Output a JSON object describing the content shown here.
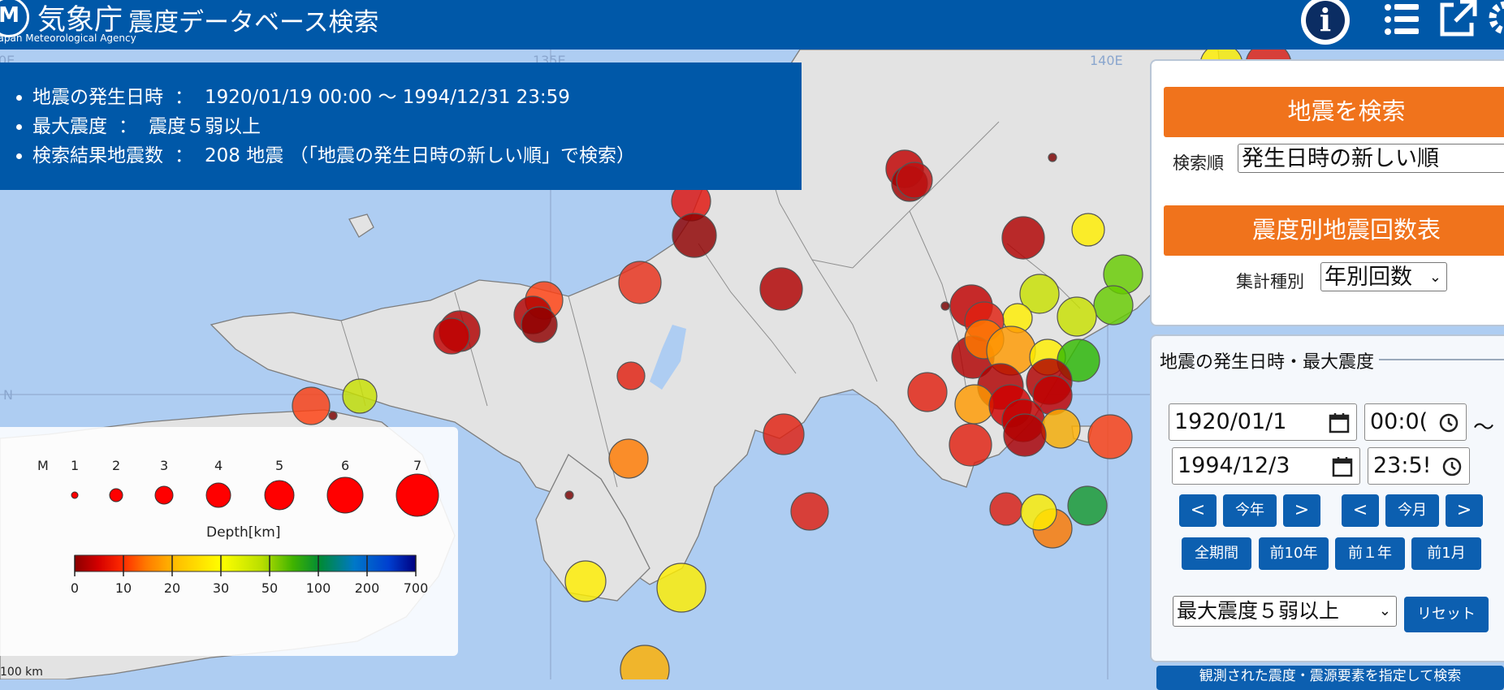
{
  "header": {
    "logo_symbol": "M",
    "agency_name": "気象庁",
    "agency_name_en": "Japan Meteorological Agency",
    "app_title": "震度データベース検索",
    "info_label": "i",
    "icons": [
      "info-icon",
      "list-icon",
      "external-link-icon",
      "gear-icon"
    ]
  },
  "map": {
    "graticule": [
      "135E",
      "140E",
      "N",
      "0E"
    ],
    "scale_label": "100 km"
  },
  "summary": {
    "items": [
      {
        "label": "地震の発生日時",
        "sep": "：",
        "value": "1920/01/19 00:00 ～ 1994/12/31 23:59"
      },
      {
        "label": "最大震度",
        "sep": "：",
        "value": "震度５弱以上"
      },
      {
        "label": "検索結果地震数",
        "sep": "：",
        "value": "208 地震 （「地震の発生日時の新しい順」で検索）"
      }
    ]
  },
  "legend": {
    "m_label": "M",
    "magnitudes": [
      "1",
      "2",
      "3",
      "4",
      "5",
      "6",
      "7"
    ],
    "depth_label": "Depth[km]",
    "depth_ticks": [
      "0",
      "10",
      "20",
      "30",
      "50",
      "100",
      "200",
      "700"
    ],
    "depth_colors": [
      "#8b0000",
      "#d40000",
      "#ff3300",
      "#ff7a00",
      "#ffc000",
      "#ffff00",
      "#c8e000",
      "#5bbf00",
      "#008a36",
      "#0078c8",
      "#003fd0",
      "#000080"
    ]
  },
  "search_panel": {
    "search_button": "地震を検索",
    "order_label": "検索順",
    "order_value": "発生日時の新しい順",
    "table_button": "震度別地震回数表",
    "agg_label": "集計種別",
    "agg_value": "年別回数"
  },
  "date_panel": {
    "title": "地震の発生日時・最大震度",
    "start_date": "1920/01/1",
    "start_time": "00:0(",
    "end_date": "1994/12/3",
    "end_time": "23:5!",
    "tilde": "～",
    "year_prev": "<",
    "year_label": "今年",
    "year_next": ">",
    "month_prev": "<",
    "month_label": "今月",
    "month_next": ">",
    "range_all": "全期間",
    "range_10y": "前10年",
    "range_1y": "前１年",
    "range_1m": "前1月",
    "intensity_value": "最大震度５弱以上",
    "reset": "リセット",
    "observed_link": "観測された震度・震源要素を指定して検索"
  },
  "colors": {
    "header_bg": "#0058a8",
    "accent_orange": "#f0731c",
    "button_blue": "#0c5fb0",
    "sea": "#aecdf2",
    "land": "#e3e3e3"
  }
}
